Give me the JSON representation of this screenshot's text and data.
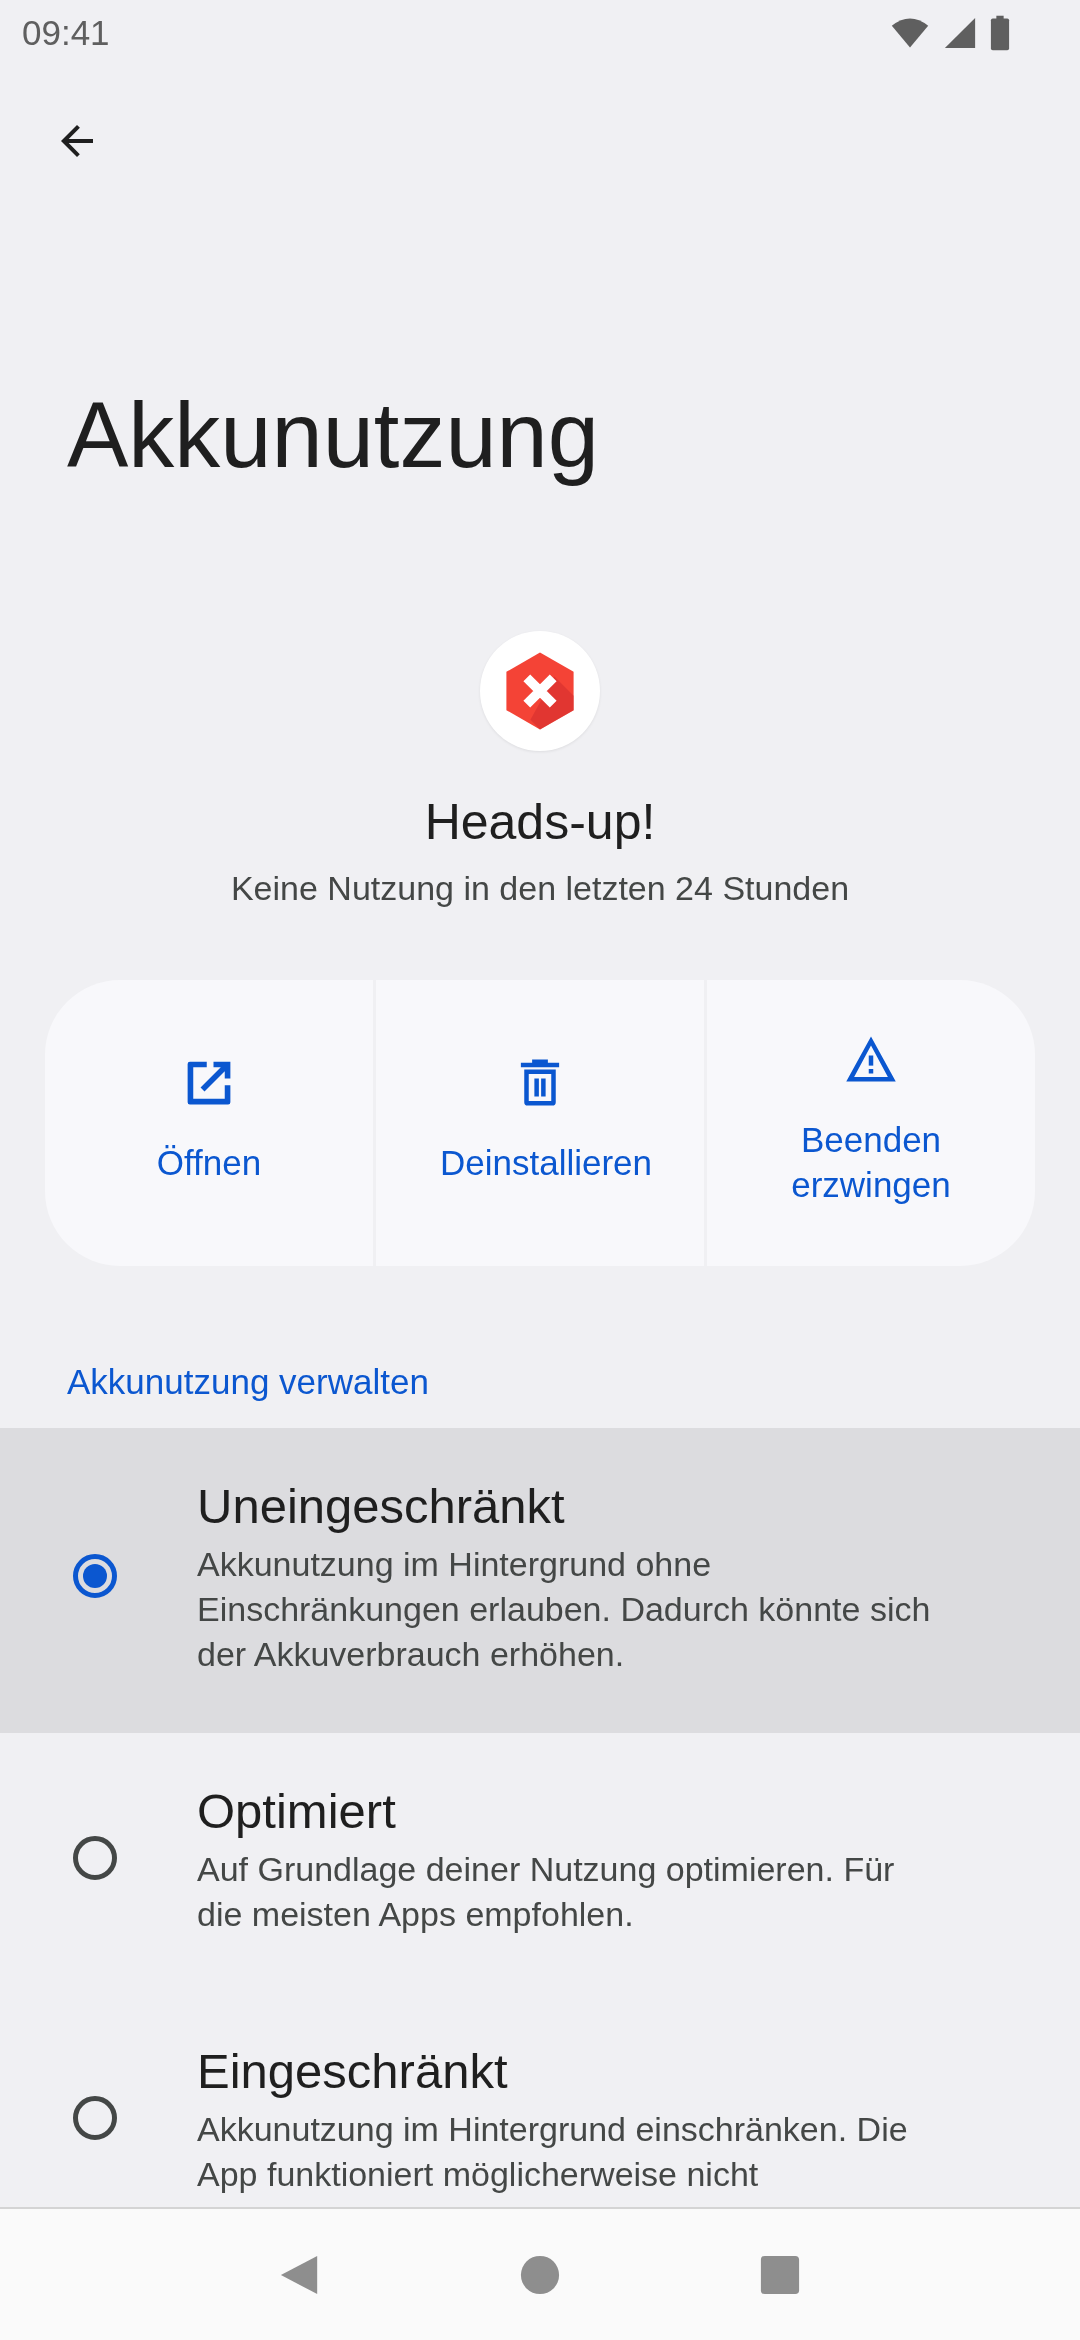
{
  "status_bar": {
    "time": "09:41"
  },
  "title": "Akkunutzung",
  "app": {
    "name": "Heads-up!",
    "usage": "Keine Nutzung in den letzten 24 Stunden"
  },
  "actions": [
    {
      "kind": "open",
      "label": "Öffnen"
    },
    {
      "kind": "uninstall",
      "label": "Deinstallieren"
    },
    {
      "kind": "force_stop",
      "label": "Beenden erzwingen"
    }
  ],
  "section_header": "Akkunutzung verwalten",
  "options": [
    {
      "title": "Uneingeschränkt",
      "description": "Akkunutzung im Hintergrund ohne Einschränkungen erlauben. Dadurch könnte sich der Akkuverbrauch erhöhen.",
      "selected": true
    },
    {
      "title": "Optimiert",
      "description": "Auf Grundlage deiner Nutzung optimieren. Für die meisten Apps empfohlen.",
      "selected": false
    },
    {
      "title": "Eingeschränkt",
      "description": "Akkunutzung im Hintergrund einschränken. Die App funktioniert möglicherweise nicht",
      "selected": false
    }
  ]
}
